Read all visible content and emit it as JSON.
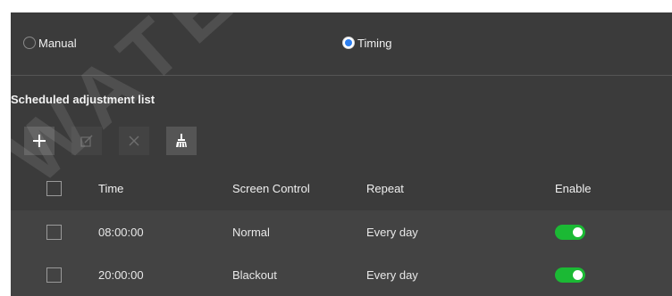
{
  "mode": {
    "options": [
      {
        "label": "Manual",
        "checked": false
      },
      {
        "label": "Timing",
        "checked": true
      }
    ]
  },
  "section_title": "Scheduled adjustment list",
  "toolbar": {
    "buttons": [
      {
        "icon": "plus-icon",
        "enabled": true
      },
      {
        "icon": "edit-icon",
        "enabled": false
      },
      {
        "icon": "delete-icon",
        "enabled": false
      },
      {
        "icon": "clear-brush-icon",
        "enabled": true
      }
    ]
  },
  "table": {
    "columns": [
      "Time",
      "Screen Control",
      "Repeat",
      "Enable"
    ],
    "rows": [
      {
        "time": "08:00:00",
        "screen_control": "Normal",
        "repeat": "Every day",
        "enabled": true
      },
      {
        "time": "20:00:00",
        "screen_control": "Blackout",
        "repeat": "Every day",
        "enabled": true
      }
    ]
  },
  "colors": {
    "panel_bg": "#3b3b3b",
    "row_bg": "#434343",
    "accent_blue": "#2d7ff0",
    "toggle_on": "#1bb934"
  }
}
